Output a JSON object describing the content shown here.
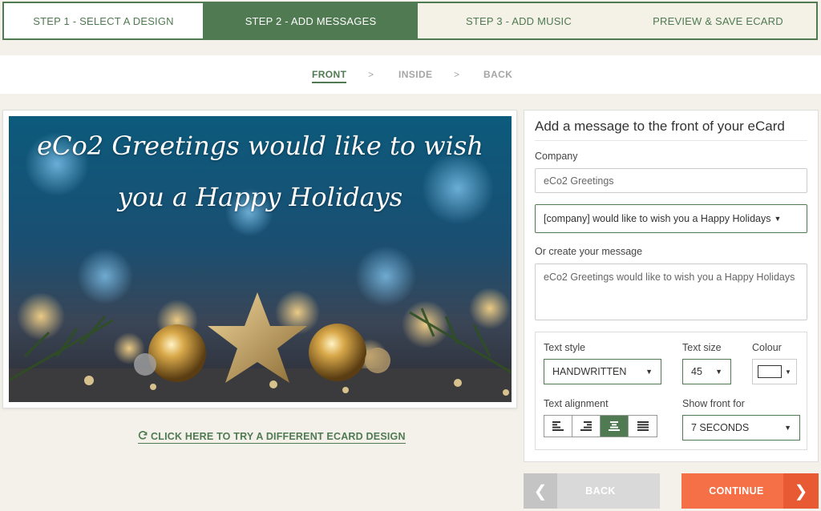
{
  "steps": [
    {
      "label": "STEP 1 - SELECT A DESIGN"
    },
    {
      "label": "STEP 2 - ADD MESSAGES"
    },
    {
      "label": "STEP 3 - ADD MUSIC"
    },
    {
      "label": "PREVIEW & SAVE ECARD"
    }
  ],
  "subnav": {
    "front": "FRONT",
    "inside": "INSIDE",
    "back": "BACK",
    "separator": ">"
  },
  "card": {
    "line1": "eCo2 Greetings would like to wish",
    "line2": "you a Happy Holidays"
  },
  "try_link": "CLICK HERE TO TRY A DIFFERENT ECARD DESIGN",
  "panel": {
    "title": "Add a message to the front of your eCard",
    "company_label": "Company",
    "company_value": "eCo2 Greetings",
    "preset_message": "[company] would like to wish you a Happy Holidays",
    "custom_label": "Or create your message",
    "custom_value": "eCo2 Greetings would like to wish you a Happy Holidays",
    "text_style_label": "Text style",
    "text_style_value": "HANDWRITTEN",
    "text_size_label": "Text size",
    "text_size_value": "45",
    "colour_label": "Colour",
    "colour_value": "#ffffff",
    "alignment_label": "Text alignment",
    "alignment_selected": "center",
    "show_front_label": "Show front for",
    "show_front_value": "7 SECONDS"
  },
  "buttons": {
    "back": "BACK",
    "continue": "CONTINUE"
  },
  "colors": {
    "accent_green": "#4f7a52",
    "continue_orange": "#f56f47",
    "background": "#f3f1ea"
  }
}
